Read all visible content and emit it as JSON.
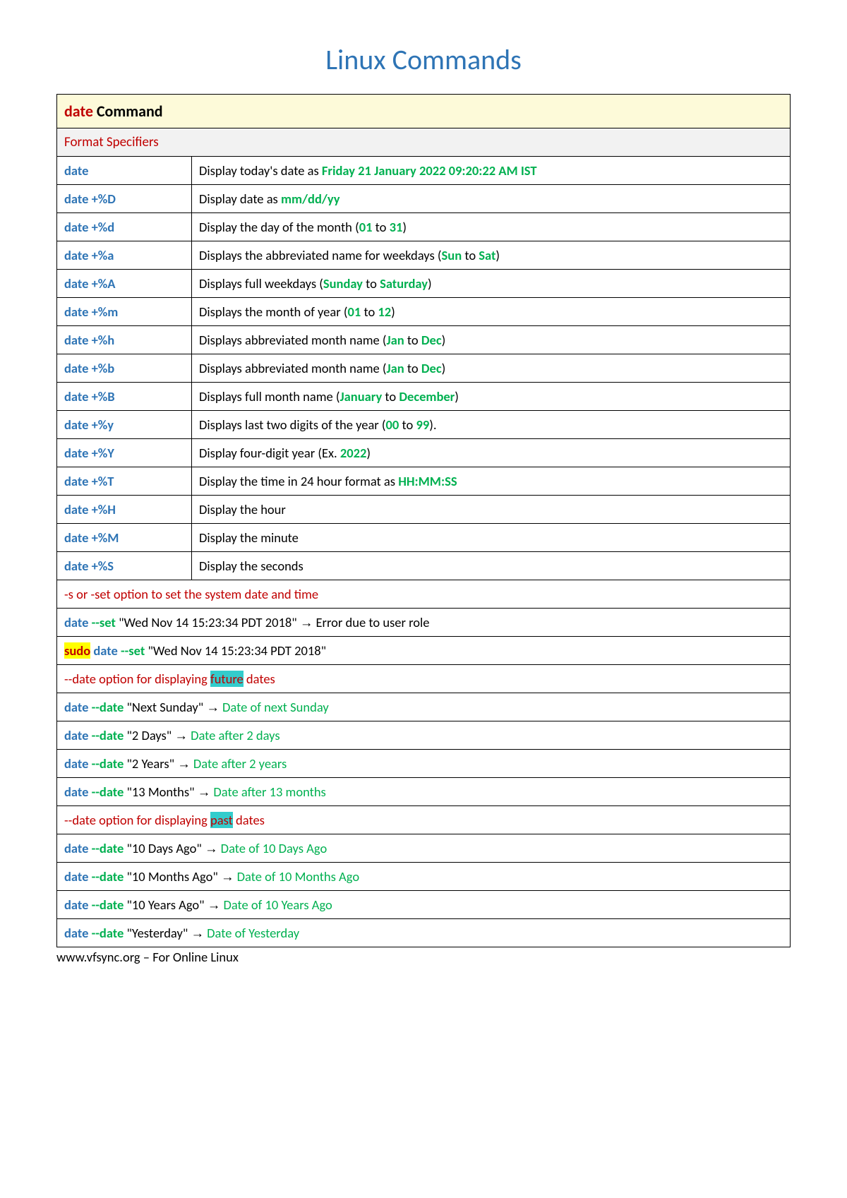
{
  "title": "Linux Commands",
  "header": {
    "cmd": "date",
    "rest": " Command"
  },
  "subhdr": "Format Specifiers",
  "rows": [
    {
      "cmd": "date",
      "desc_pre": "Display today's date as ",
      "hl": "Friday 21 January 2022 09:20:22 AM IST",
      "desc_post": ""
    },
    {
      "cmd": "date +%D",
      "desc_pre": "Display date as ",
      "hl": "mm/dd/yy",
      "desc_post": ""
    },
    {
      "cmd": "date +%d",
      "desc_pre": "Display the day of the month (",
      "hl1": "01",
      "mid": " to ",
      "hl2": "31",
      "desc_post": ")"
    },
    {
      "cmd": "date +%a",
      "desc_pre": "Displays the abbreviated name for weekdays (",
      "hl1": "Sun",
      "mid": " to ",
      "hl2": "Sat",
      "desc_post": ")"
    },
    {
      "cmd": "date +%A",
      "desc_pre": "Displays full weekdays (",
      "hl1": "Sunday",
      "mid": " to ",
      "hl2": "Saturday",
      "desc_post": ")"
    },
    {
      "cmd": "date +%m",
      "desc_pre": "Displays the month of year (",
      "hl1": "01",
      "mid": " to ",
      "hl2": "12",
      "desc_post": ")"
    },
    {
      "cmd": "date +%h",
      "desc_pre": "Displays abbreviated month name (",
      "hl1": "Jan",
      "mid": " to ",
      "hl2": "Dec",
      "desc_post": ")"
    },
    {
      "cmd": "date +%b",
      "desc_pre": "Displays abbreviated month name (",
      "hl1": "Jan",
      "mid": " to ",
      "hl2": "Dec",
      "desc_post": ")"
    },
    {
      "cmd": "date +%B",
      "desc_pre": "Displays full month name (",
      "hl1": "January",
      "mid": " to ",
      "hl2": "December",
      "desc_post": ")"
    },
    {
      "cmd": "date +%y",
      "desc_pre": "Displays last two digits of the year (",
      "hl1": "00",
      "mid": " to ",
      "hl2": "99",
      "desc_post": ")."
    },
    {
      "cmd": "date +%Y",
      "desc_pre": "Display four-digit year (Ex. ",
      "hl": "2022",
      "desc_post": ")"
    },
    {
      "cmd": "date +%T",
      "desc_pre": "Display the time in 24 hour format as ",
      "hl": "HH:MM:SS",
      "desc_post": ""
    },
    {
      "cmd": "date +%H",
      "desc_pre": "Display the hour"
    },
    {
      "cmd": "date +%M",
      "desc_pre": "Display the minute"
    },
    {
      "cmd": "date +%S",
      "desc_pre": "Display the seconds"
    }
  ],
  "set_option_note": "-s or -set option to set the system date and time",
  "set_ex1": {
    "cmd": "date ",
    "opt": "--set",
    "arg": " \"Wed Nov 14 15:23:34 PDT 2018\"  ",
    "arrow": "→",
    "res": " Error due to user role"
  },
  "set_ex2": {
    "sudo": "sudo",
    "sp": " ",
    "cmd": "date ",
    "opt": "--set",
    "arg": " \"Wed Nov 14 15:23:34 PDT 2018\""
  },
  "future_note": {
    "pre": "--date option for displaying ",
    "hl": "future",
    "post": " dates"
  },
  "future_ex": [
    {
      "cmd": "date ",
      "opt": "--date",
      "arg": " \"Next Sunday\" ",
      "arrow": "→",
      "res": " Date of next Sunday"
    },
    {
      "cmd": "date ",
      "opt": "--date",
      "arg": " \"2 Days\" ",
      "arrow": "→",
      "res": " Date after 2 days"
    },
    {
      "cmd": "date ",
      "opt": "--date",
      "arg": " \"2 Years\" ",
      "arrow": "→",
      "res": " Date after 2 years"
    },
    {
      "cmd": "date ",
      "opt": "--date",
      "arg": " \"13 Months\" ",
      "arrow": "→",
      "res": " Date after 13 months"
    }
  ],
  "past_note": {
    "pre": "--date option for displaying ",
    "hl": "past",
    "post": " dates"
  },
  "past_ex": [
    {
      "cmd": "date ",
      "opt": "--date",
      "arg": " \"10 Days Ago\" ",
      "arrow": "→",
      "res": " Date of 10 Days Ago"
    },
    {
      "cmd": "date ",
      "opt": "--date",
      "arg": " \"10 Months Ago\" ",
      "arrow": "→",
      "res": " Date of 10 Months Ago"
    },
    {
      "cmd": "date ",
      "opt": "--date",
      "arg": " \"10 Years Ago\" ",
      "arrow": "→",
      "res": " Date of 10 Years Ago"
    },
    {
      "cmd": "date ",
      "opt": "--date",
      "arg": " \"Yesterday\" ",
      "arrow": "→",
      "res": " Date of Yesterday"
    }
  ],
  "footer": "www.vfsync.org – For Online Linux"
}
